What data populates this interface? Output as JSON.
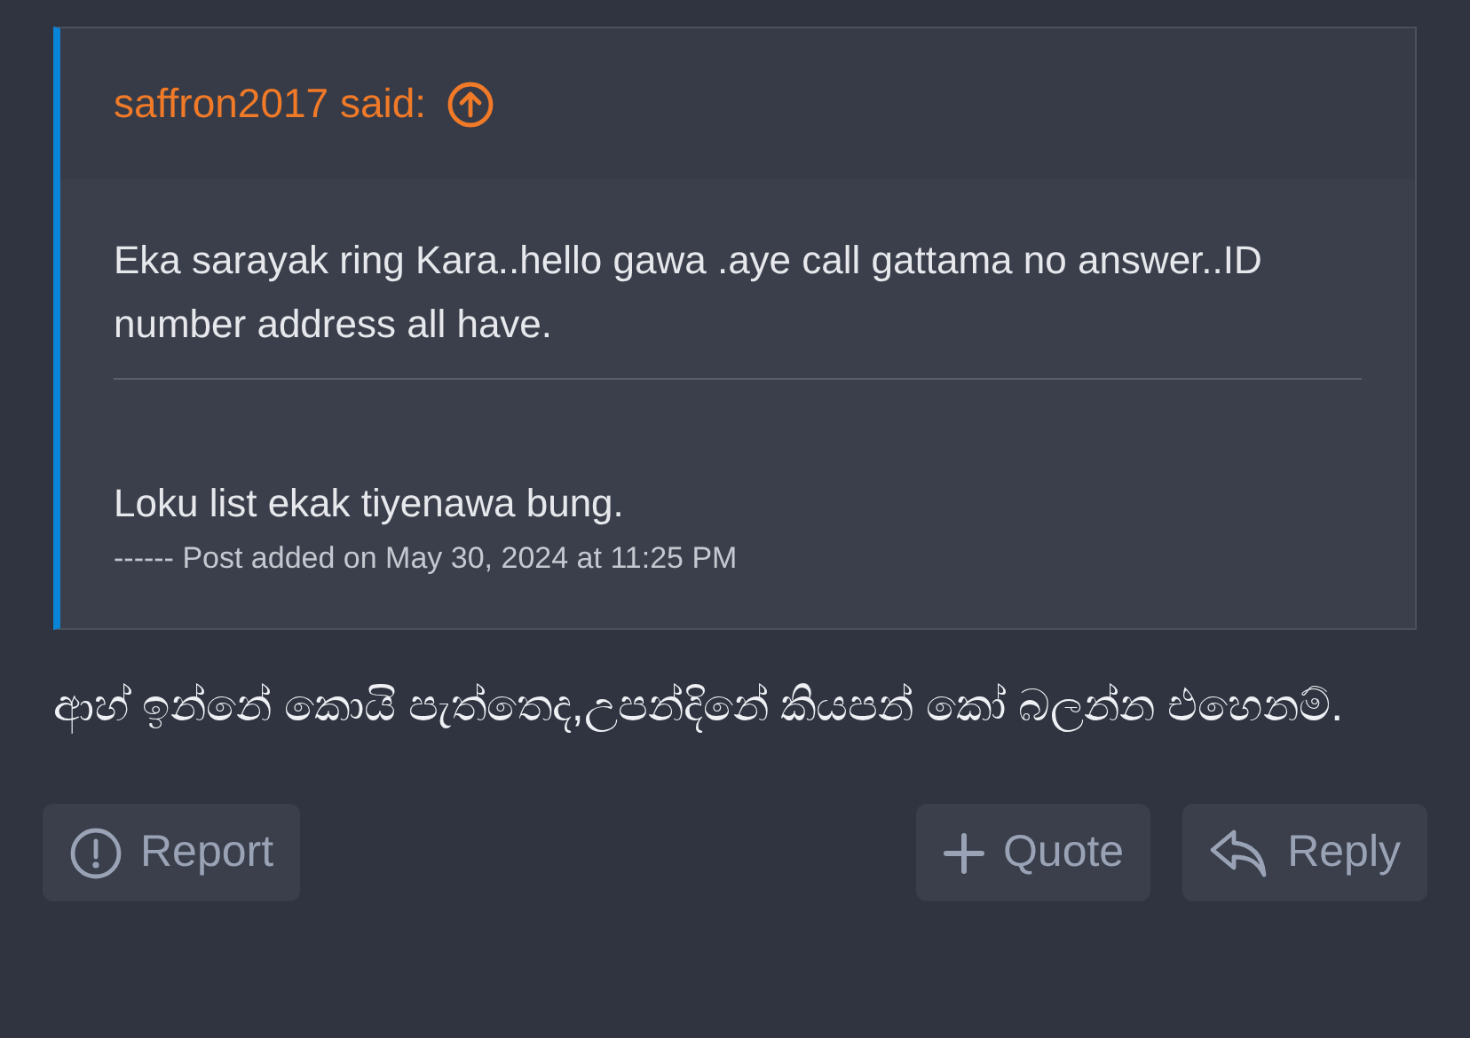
{
  "quote": {
    "header": "saffron2017 said:",
    "blocks": [
      {
        "kind": "text",
        "text": "Eka sarayak ring Kara..hello gawa .aye call gattama no answer..ID number address all have."
      },
      {
        "kind": "rule"
      },
      {
        "kind": "text",
        "text": "Loku list ekak tiyenawa bung."
      },
      {
        "kind": "note",
        "text": "------ Post added on May 30, 2024 at 11:25 PM"
      }
    ]
  },
  "post_text": "ආහ් ඉන්නේ කොයි පැත්තෙද,උපන්දිනේ කියපන් කෝ බලන්න එහෙනම්.",
  "actions": [
    {
      "kind": "report",
      "label": "Report"
    },
    {
      "kind": "quote",
      "label": "Quote"
    },
    {
      "kind": "reply",
      "label": "Reply"
    }
  ]
}
